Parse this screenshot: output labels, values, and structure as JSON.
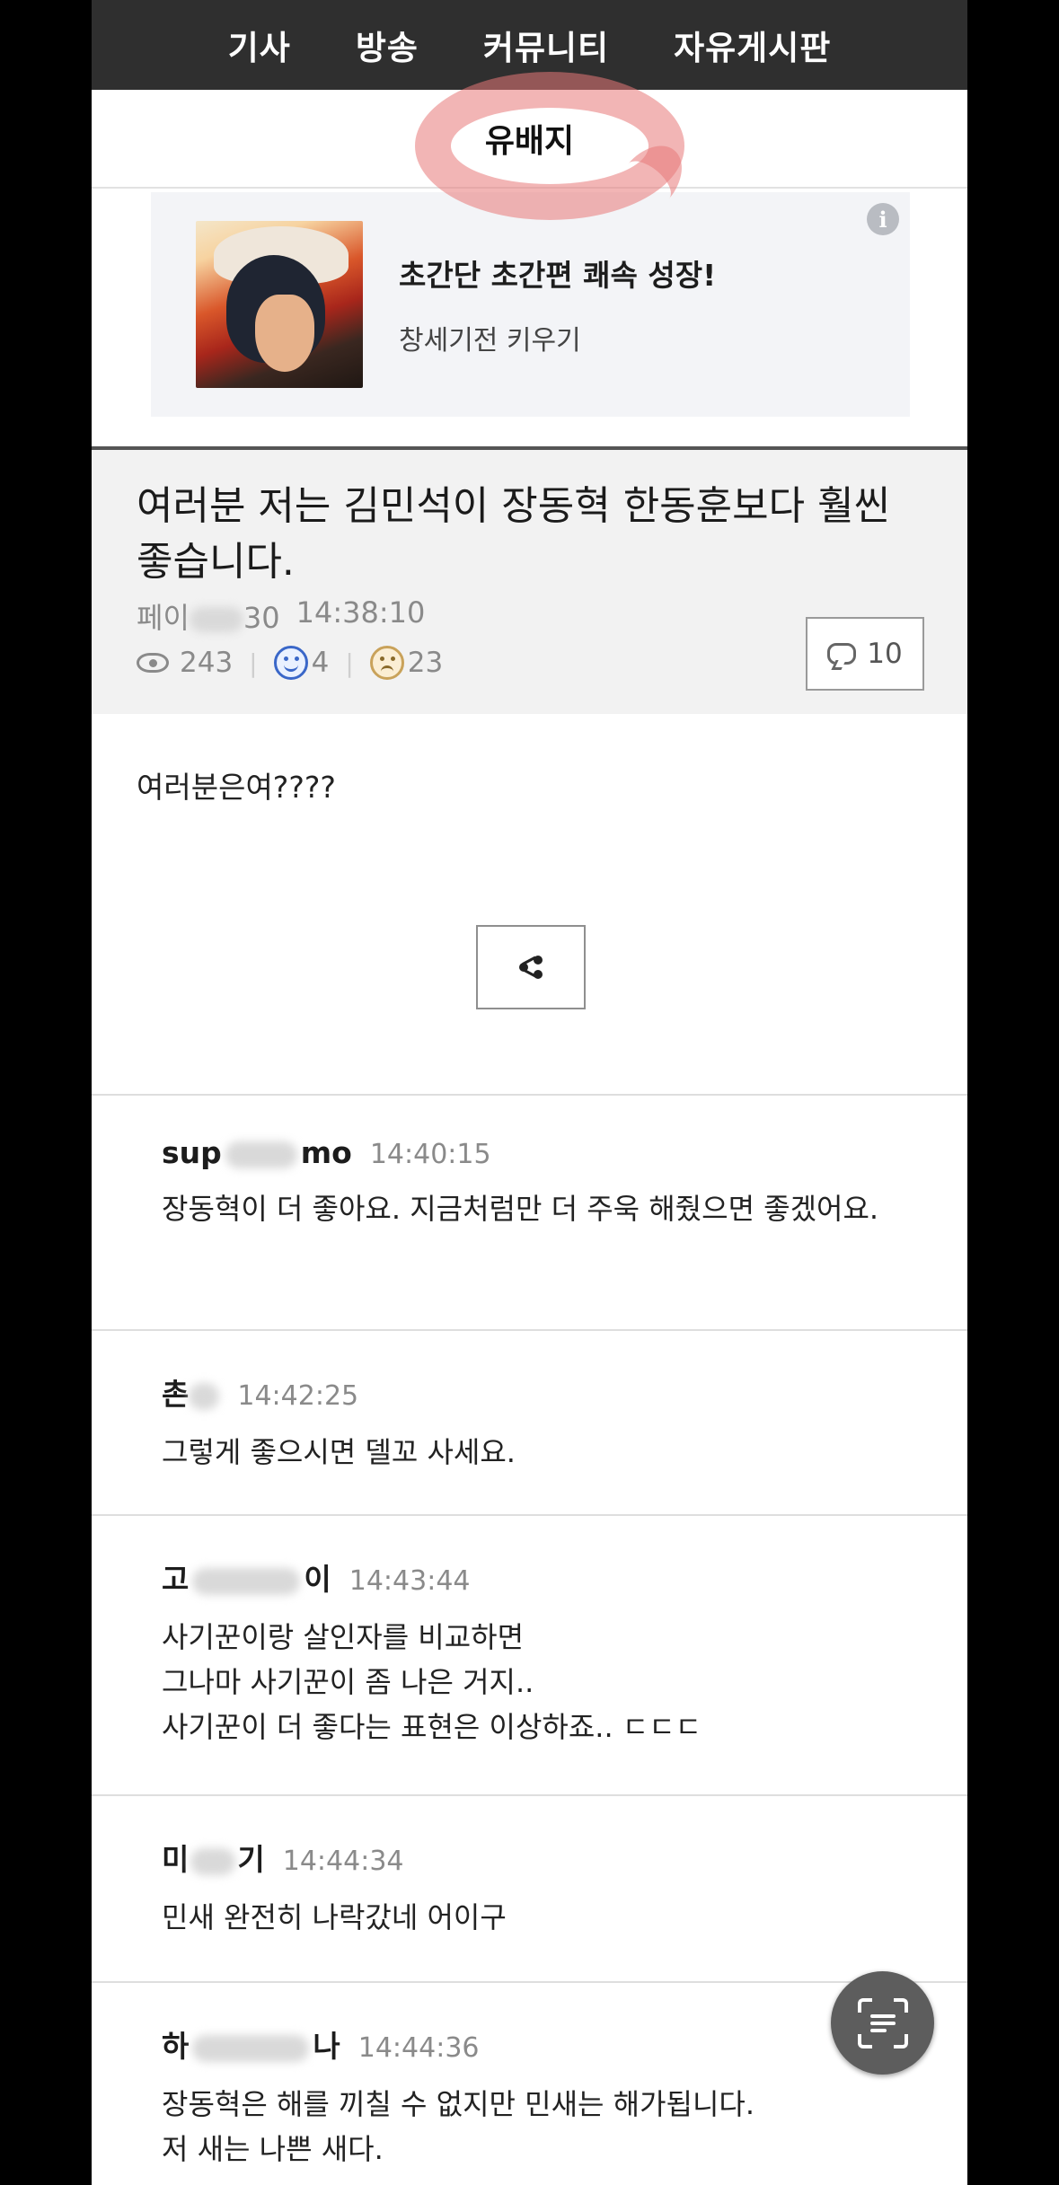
{
  "nav": {
    "items": [
      "기사",
      "방송",
      "커뮤니티",
      "자유게시판"
    ]
  },
  "board": {
    "title": "유배지"
  },
  "ad": {
    "title": "초간단 초간편 쾌속 성장!",
    "subtitle": "창세기전 키우기",
    "info_icon": "info-icon"
  },
  "post": {
    "title": "여러분 저는 김민석이 장동혁 한동훈보다 훨씬 좋습니다.",
    "author_prefix": "페이",
    "author_suffix": "30",
    "time": "14:38:10",
    "views": "243",
    "likes": "4",
    "dislikes": "23",
    "comment_count": "10",
    "body": "여러분은여????"
  },
  "comments": [
    {
      "author_prefix": "sup",
      "author_suffix": "mo",
      "time": "14:40:15",
      "text": "장동혁이 더 좋아요. 지금처럼만 더 주욱 해줬으면 좋겠어요."
    },
    {
      "author_prefix": "촌",
      "author_suffix": "",
      "time": "14:42:25",
      "text": "그렇게 좋으시면 델꼬 사세요."
    },
    {
      "author_prefix": "고",
      "author_suffix": "이",
      "time": "14:43:44",
      "text": "사기꾼이랑 살인자를 비교하면\n그나마 사기꾼이 좀 나은 거지..\n사기꾼이 더 좋다는 표현은 이상하죠.. ㄷㄷㄷ"
    },
    {
      "author_prefix": "미",
      "author_suffix": "기",
      "time": "14:44:34",
      "text": "민새 완전히 나락갔네 어이구"
    },
    {
      "author_prefix": "하",
      "author_suffix": "나",
      "time": "14:44:36",
      "text": "장동혁은 해를 끼칠 수 없지만 민새는 해가됩니다.\n저 새는 나쁜 새다."
    }
  ]
}
